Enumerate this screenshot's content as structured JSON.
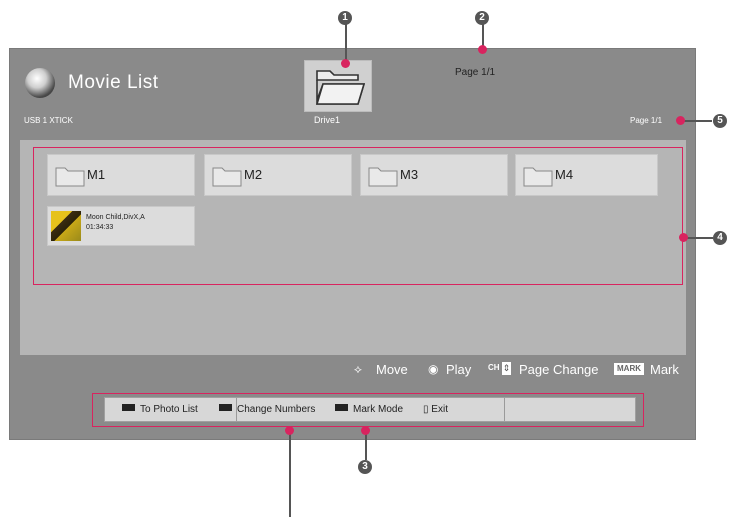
{
  "header": {
    "title": "Movie List",
    "usb_label": "USB 1 XTICK",
    "drive_label": "Drive1",
    "page_top": "Page 1/1",
    "page_right": "Page 1/1"
  },
  "folders": [
    {
      "label": "M1"
    },
    {
      "label": "M2"
    },
    {
      "label": "M3"
    },
    {
      "label": "M4"
    }
  ],
  "video": {
    "name": "Moon Child,DivX,A",
    "duration": "01:34:33"
  },
  "hints": {
    "move_icon": "⟡",
    "move": "Move",
    "play_icon": "◉",
    "play": "Play",
    "ch_badge": "CH",
    "ch_arrows": "⇕",
    "page_change": "Page Change",
    "mark_badge": "MARK",
    "mark": "Mark"
  },
  "bottom_bar": {
    "photo_list": "To Photo List",
    "change_numbers": "Change Numbers",
    "mark_mode": "Mark Mode",
    "exit_icon": "▯",
    "exit": "Exit"
  },
  "callouts": {
    "one": "1",
    "two": "2",
    "three": "3",
    "four": "4",
    "five": "5"
  },
  "icons": {
    "title_icon": "movie-disc-icon",
    "drive_icon": "open-folder-icon",
    "folder_icon": "folder-icon",
    "thumbnail": "video-thumbnail"
  },
  "colors": {
    "screen_bg": "#8a8a8a",
    "content_bg": "#b5b5b5",
    "highlight": "#d8245f",
    "callout": "#555555"
  }
}
